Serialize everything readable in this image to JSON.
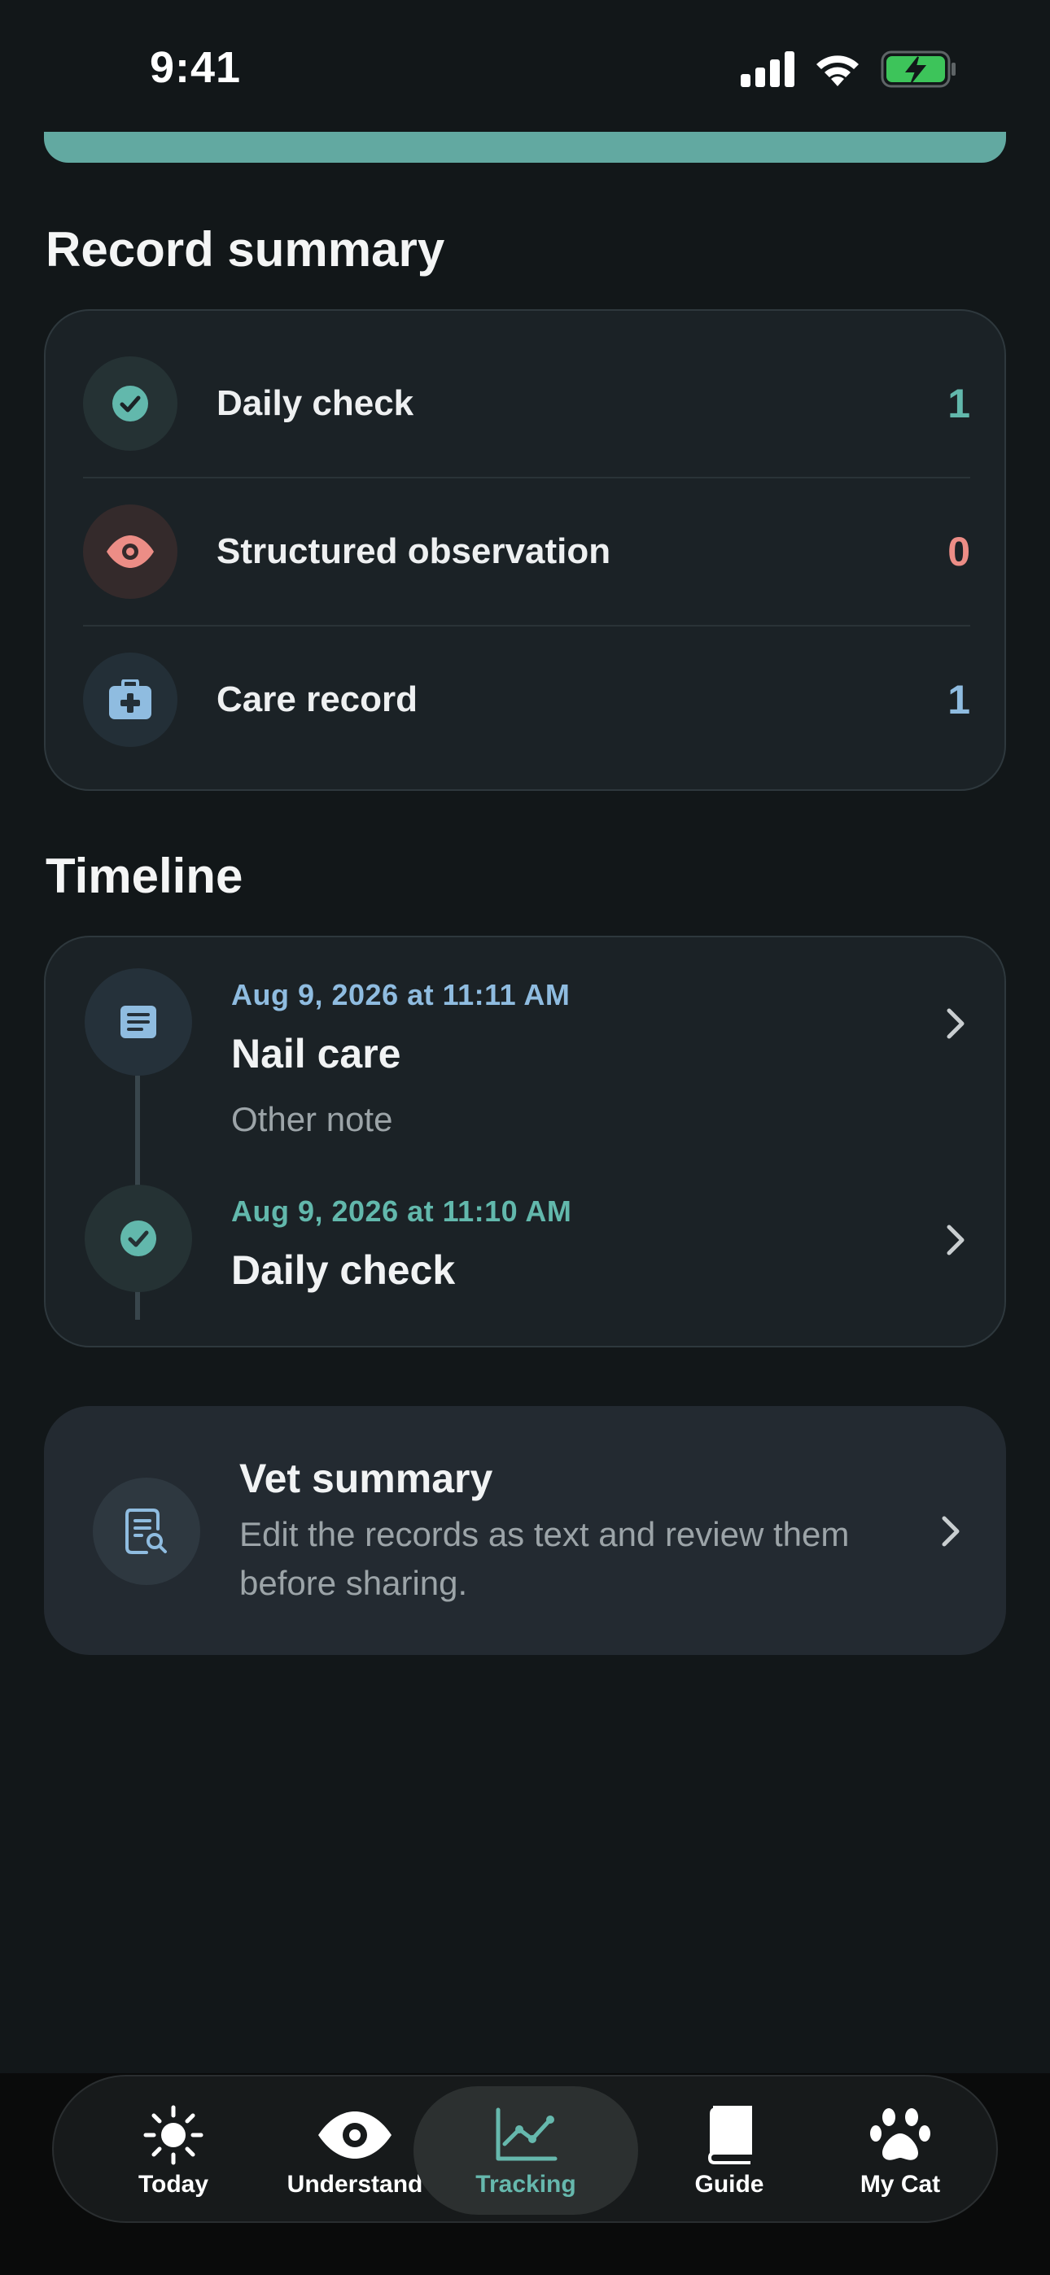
{
  "status_bar": {
    "time": "9:41",
    "icons": [
      "signal-icon",
      "wifi-icon",
      "battery-charging-icon"
    ]
  },
  "record_summary": {
    "title": "Record summary",
    "rows": [
      {
        "label": "Daily check",
        "count": "1",
        "icon": "checkmark-circle-icon",
        "accent": "#62B8AC"
      },
      {
        "label": "Structured observation",
        "count": "0",
        "icon": "eye-icon",
        "accent": "#EC8D86"
      },
      {
        "label": "Care record",
        "count": "1",
        "icon": "medical-kit-icon",
        "accent": "#8FBCE0"
      }
    ]
  },
  "timeline": {
    "title": "Timeline",
    "entries": [
      {
        "date": "Aug 9, 2026 at 11:11 AM",
        "title": "Nail care",
        "note": "Other note",
        "icon": "note-icon",
        "date_color": "#8FBCE0"
      },
      {
        "date": "Aug 9, 2026 at 11:10 AM",
        "title": "Daily check",
        "note": "",
        "icon": "checkmark-circle-icon",
        "date_color": "#62B8AC"
      }
    ]
  },
  "vet_summary": {
    "title": "Vet summary",
    "description": "Edit the records as text and review them before sharing.",
    "icon": "document-search-icon"
  },
  "tab_bar": {
    "active": "Tracking",
    "tabs": [
      {
        "label": "Today",
        "icon": "sun-icon"
      },
      {
        "label": "Understand",
        "icon": "eye-icon"
      },
      {
        "label": "Tracking",
        "icon": "chart-line-icon"
      },
      {
        "label": "Guide",
        "icon": "book-icon"
      },
      {
        "label": "My Cat",
        "icon": "paw-icon"
      }
    ]
  },
  "colors": {
    "background": "#121719",
    "card": "#1B2226",
    "accent_teal": "#62B8AC",
    "accent_coral": "#EC8D86",
    "accent_blue": "#8FBCE0"
  }
}
